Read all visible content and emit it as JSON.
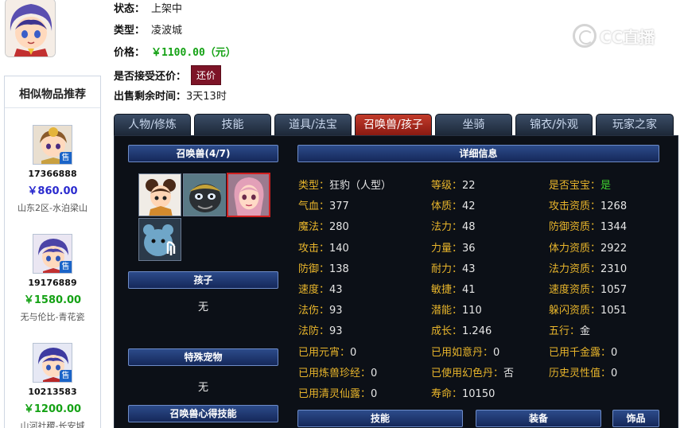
{
  "header": {
    "status_label": "状态：",
    "status_value": "上架中",
    "type_label": "类型：",
    "type_value": "凌波城",
    "price_label": "价格：",
    "price_value": "￥1100.00（元）",
    "bargain_label": "是否接受还价：",
    "bargain_button": "还价",
    "time_label": "出售剩余时间：",
    "time_value": "3天13时"
  },
  "watermark": {
    "text": "CC直播"
  },
  "similar": {
    "title": "相似物品推荐",
    "items": [
      {
        "id": "17366888",
        "price": "￥860.00",
        "price_color": "#2b2bcf",
        "server": "山东2区-水泊梁山",
        "badge": "售"
      },
      {
        "id": "19176889",
        "price": "￥1580.00",
        "price_color": "#15a215",
        "server": "无与伦比-青花瓷",
        "badge": "售"
      },
      {
        "id": "10213583",
        "price": "￥1200.00",
        "price_color": "#15a215",
        "server": "山河社稷-长安城",
        "badge": "售"
      }
    ]
  },
  "tabs": [
    {
      "label": "人物/修炼",
      "active": false
    },
    {
      "label": "技能",
      "active": false
    },
    {
      "label": "道具/法宝",
      "active": false
    },
    {
      "label": "召唤兽/孩子",
      "active": true
    },
    {
      "label": "坐骑",
      "active": false
    },
    {
      "label": "锦衣/外观",
      "active": false
    },
    {
      "label": "玩家之家",
      "active": false
    }
  ],
  "panel": {
    "summon_title": "召唤兽(4/7)",
    "child_title": "孩子",
    "child_value": "无",
    "special_title": "特殊宠物",
    "special_value": "无",
    "skill_book_title": "召唤兽心得技能",
    "detail_title": "详细信息",
    "bottom_tabs": {
      "skills": "技能",
      "equip": "装备",
      "ornament": "饰品"
    },
    "attrs": [
      [
        {
          "k": "类型：",
          "v": "狂豹（人型）"
        },
        {
          "k": "等级：",
          "v": "22"
        },
        {
          "k": "是否宝宝：",
          "v": "是",
          "green": true
        }
      ],
      [
        {
          "k": "气血：",
          "v": "377"
        },
        {
          "k": "体质：",
          "v": "42"
        },
        {
          "k": "攻击资质：",
          "v": "1268"
        }
      ],
      [
        {
          "k": "魔法：",
          "v": "280"
        },
        {
          "k": "法力：",
          "v": "48"
        },
        {
          "k": "防御资质：",
          "v": "1344"
        }
      ],
      [
        {
          "k": "攻击：",
          "v": "140"
        },
        {
          "k": "力量：",
          "v": "36"
        },
        {
          "k": "体力资质：",
          "v": "2922"
        }
      ],
      [
        {
          "k": "防御：",
          "v": "138"
        },
        {
          "k": "耐力：",
          "v": "43"
        },
        {
          "k": "法力资质：",
          "v": "2310"
        }
      ],
      [
        {
          "k": "速度：",
          "v": "43"
        },
        {
          "k": "敏捷：",
          "v": "41"
        },
        {
          "k": "速度资质：",
          "v": "1057"
        }
      ],
      [
        {
          "k": "法伤：",
          "v": "93"
        },
        {
          "k": "潜能：",
          "v": "110"
        },
        {
          "k": "躲闪资质：",
          "v": "1051"
        }
      ],
      [
        {
          "k": "法防：",
          "v": "93"
        },
        {
          "k": "成长：",
          "v": "1.246"
        },
        {
          "k": "五行：",
          "v": "金"
        }
      ],
      [
        {
          "k": "已用元宵：",
          "v": "0"
        },
        {
          "k": "已用如意丹：",
          "v": "0"
        },
        {
          "k": "已用千金露：",
          "v": "0"
        }
      ],
      [
        {
          "k": "已用炼兽珍经：",
          "v": "0"
        },
        {
          "k": "已使用幻色丹：",
          "v": "否"
        },
        {
          "k": "历史灵性值：",
          "v": "0"
        }
      ],
      [
        {
          "k": "已用清灵仙露：",
          "v": "0"
        },
        {
          "k": "寿命：",
          "v": "10150"
        },
        null
      ]
    ]
  }
}
